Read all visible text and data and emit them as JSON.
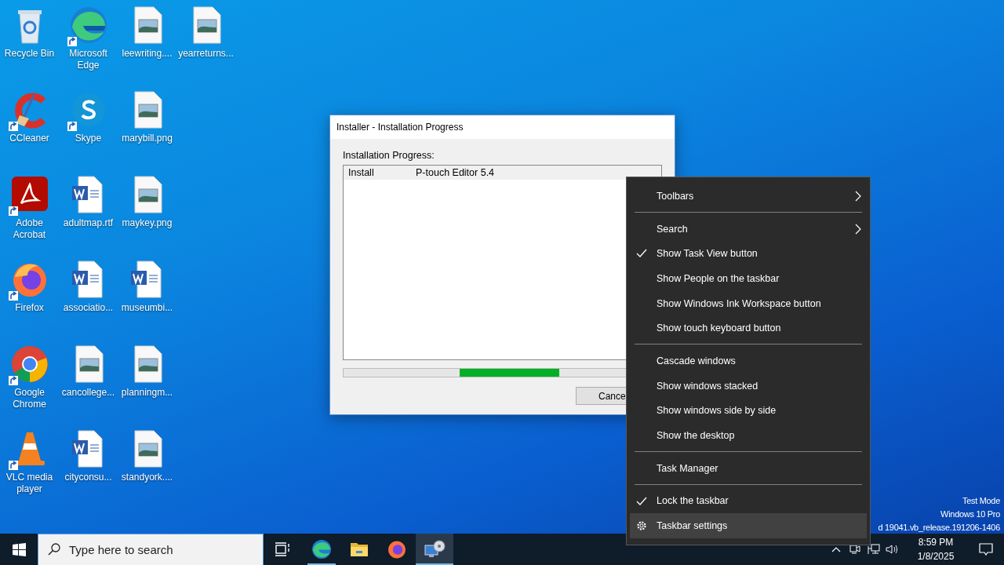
{
  "desktop_icons": [
    {
      "label": "Recycle Bin",
      "kind": "recycle",
      "shortcut": false
    },
    {
      "label": "CCleaner",
      "kind": "ccleaner",
      "shortcut": true
    },
    {
      "label": "Adobe Acrobat",
      "kind": "acrobat",
      "shortcut": true
    },
    {
      "label": "Firefox",
      "kind": "firefox",
      "shortcut": true
    },
    {
      "label": "Google Chrome",
      "kind": "chrome",
      "shortcut": true
    },
    {
      "label": "VLC media player",
      "kind": "vlc",
      "shortcut": true
    },
    {
      "label": "Microsoft Edge",
      "kind": "edge",
      "shortcut": true
    },
    {
      "label": "Skype",
      "kind": "skype",
      "shortcut": true
    },
    {
      "label": "adultmap.rtf",
      "kind": "word",
      "shortcut": false
    },
    {
      "label": "associatio...",
      "kind": "word",
      "shortcut": false
    },
    {
      "label": "cancollege...",
      "kind": "image",
      "shortcut": false
    },
    {
      "label": "cityconsu...",
      "kind": "word",
      "shortcut": false
    },
    {
      "label": "leewriting....",
      "kind": "image",
      "shortcut": false
    },
    {
      "label": "marybill.png",
      "kind": "image",
      "shortcut": false
    },
    {
      "label": "maykey.png",
      "kind": "image",
      "shortcut": false
    },
    {
      "label": "museumbi...",
      "kind": "word",
      "shortcut": false
    },
    {
      "label": "planningm...",
      "kind": "image",
      "shortcut": false
    },
    {
      "label": "standyork....",
      "kind": "image",
      "shortcut": false
    },
    {
      "label": "yearreturns...",
      "kind": "image",
      "shortcut": false
    }
  ],
  "installer_window": {
    "title": "Installer - Installation Progress",
    "label": "Installation Progress:",
    "rows": [
      {
        "action": "Install",
        "item": "P-touch Editor 5.4"
      }
    ],
    "cancel_button": "Cance"
  },
  "context_menu": [
    {
      "kind": "submenu",
      "label": "Toolbars",
      "checked": false,
      "selected": false
    },
    {
      "kind": "separator"
    },
    {
      "kind": "submenu",
      "label": "Search",
      "checked": false,
      "selected": false
    },
    {
      "kind": "item",
      "label": "Show Task View button",
      "checked": true,
      "selected": false
    },
    {
      "kind": "item",
      "label": "Show People on the taskbar",
      "checked": false,
      "selected": false
    },
    {
      "kind": "item",
      "label": "Show Windows Ink Workspace button",
      "checked": false,
      "selected": false
    },
    {
      "kind": "item",
      "label": "Show touch keyboard button",
      "checked": false,
      "selected": false
    },
    {
      "kind": "separator"
    },
    {
      "kind": "item",
      "label": "Cascade windows",
      "checked": false,
      "selected": false
    },
    {
      "kind": "item",
      "label": "Show windows stacked",
      "checked": false,
      "selected": false
    },
    {
      "kind": "item",
      "label": "Show windows side by side",
      "checked": false,
      "selected": false
    },
    {
      "kind": "item",
      "label": "Show the desktop",
      "checked": false,
      "selected": false
    },
    {
      "kind": "separator"
    },
    {
      "kind": "item",
      "label": "Task Manager",
      "checked": false,
      "selected": false
    },
    {
      "kind": "separator"
    },
    {
      "kind": "item",
      "label": "Lock the taskbar",
      "checked": true,
      "selected": false
    },
    {
      "kind": "settings",
      "label": "Taskbar settings",
      "checked": false,
      "selected": true
    }
  ],
  "system_watermark": [
    "Test Mode",
    "Windows 10 Pro",
    "d 19041.vb_release.191206-1406"
  ],
  "taskbar": {
    "search": {
      "placeholder": "Type here to search"
    },
    "apps": [
      {
        "kind": "edge",
        "running": true,
        "selected": false
      },
      {
        "kind": "explorer",
        "running": false,
        "selected": false
      },
      {
        "kind": "firefox",
        "running": false,
        "selected": false
      },
      {
        "kind": "installer",
        "running": true,
        "selected": true
      }
    ],
    "clock": {
      "time": "8:59 PM",
      "date": "1/8/2025"
    }
  }
}
